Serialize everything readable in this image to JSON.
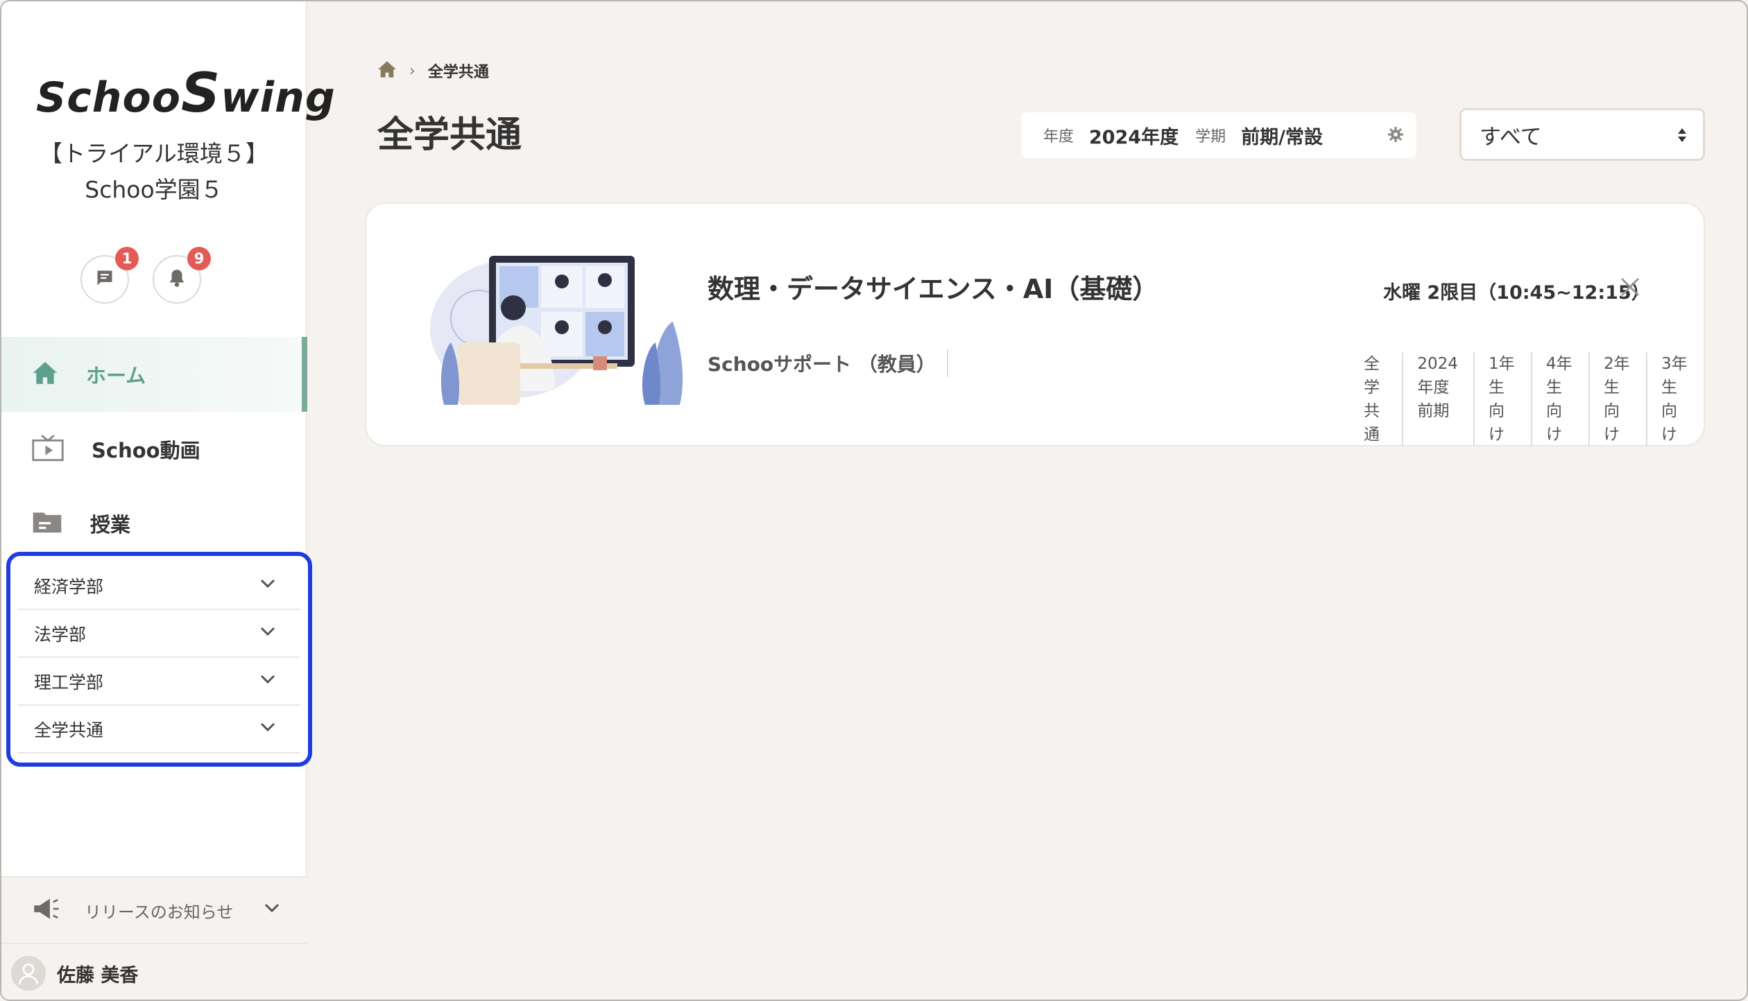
{
  "app": {
    "logo_text_a": "Schoo",
    "logo_text_s": "S",
    "logo_text_b": "wing",
    "org_name": "【トライアル環境５】Schoo学園５"
  },
  "notifications": {
    "messages_count": "1",
    "bell_count": "9"
  },
  "sidebar": {
    "nav": [
      {
        "label": "ホーム",
        "icon": "home-icon",
        "active": true
      },
      {
        "label": "Schoo動画",
        "icon": "tv-icon",
        "active": false
      },
      {
        "label": "授業",
        "icon": "folder-icon",
        "active": false
      }
    ],
    "faculties": [
      {
        "label": "経済学部"
      },
      {
        "label": "法学部"
      },
      {
        "label": "理工学部"
      },
      {
        "label": "全学共通"
      }
    ],
    "release_label": "リリースのお知らせ",
    "user_name": "佐藤 美香"
  },
  "main": {
    "breadcrumb_current": "全学共通",
    "page_title": "全学共通",
    "term": {
      "year_key": "年度",
      "year_value": "2024年度",
      "term_key": "学期",
      "term_value": "前期/常設"
    },
    "filter_select": "すべて"
  },
  "course": {
    "title": "数理・データサイエンス・AI（基礎）",
    "schedule": "水曜 2限目（10:45~12:15）",
    "teacher": "Schooサポート （教員）",
    "tags": [
      "全学共通",
      "2024年度 前期",
      "1年生向け",
      "4年生向け",
      "2年生向け",
      "3年生向け"
    ]
  },
  "colors": {
    "accent": "#5f9f8e",
    "highlight_border": "#1f3ce0",
    "badge": "#e35a57",
    "background": "#f5f2ef"
  }
}
